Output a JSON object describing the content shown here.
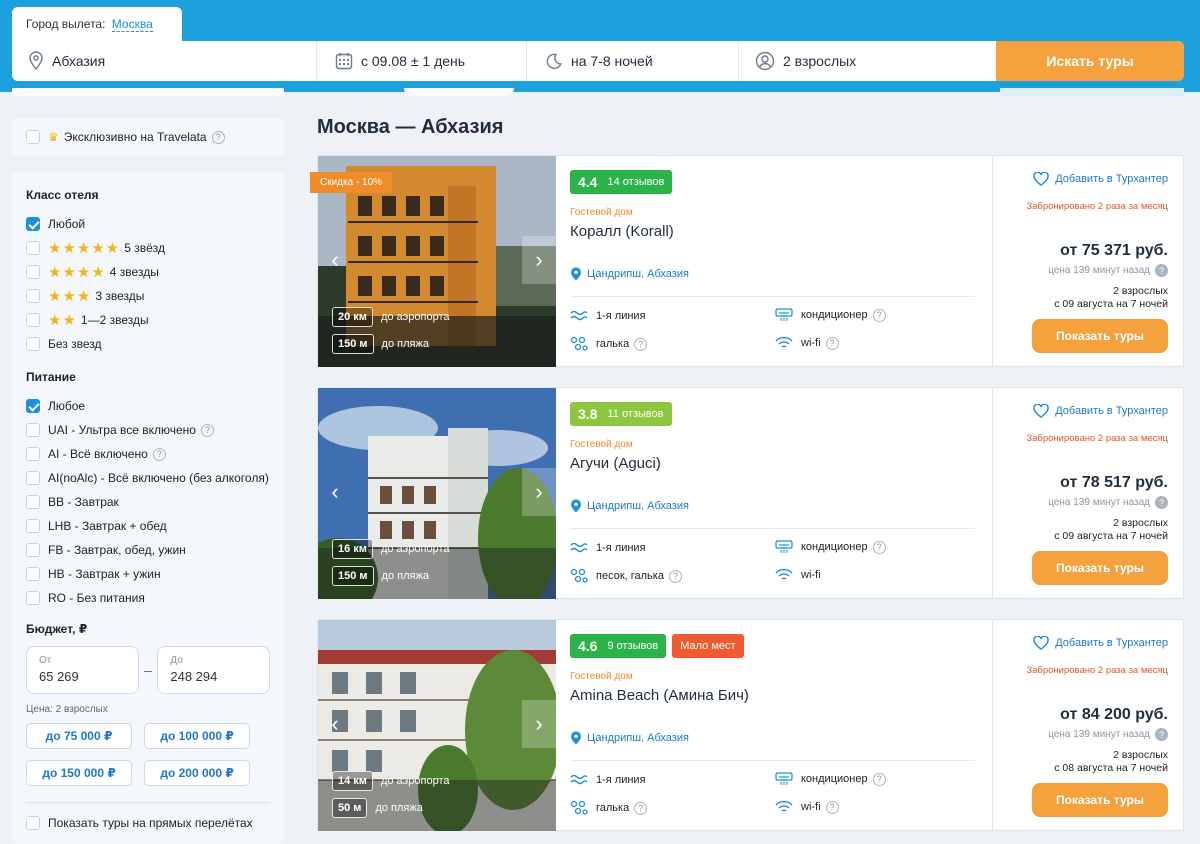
{
  "search": {
    "departure_label": "Город вылета:",
    "departure_city": "Москва",
    "destination": "Абхазия",
    "date": "с 09.08 ± 1 день",
    "nights": "на 7-8 ночей",
    "people": "2 взрослых",
    "button": "Искать туры"
  },
  "sidebar": {
    "exclusive_label": "Эксклюзивно на Travelata",
    "hotel_class": {
      "title": "Класс отеля",
      "options": [
        {
          "label": "Любой",
          "checked": true
        },
        {
          "label": "5 звёзд",
          "stars": "★★★★★"
        },
        {
          "label": "4 звезды",
          "stars": "★★★★"
        },
        {
          "label": "3 звезды",
          "stars": "★★★"
        },
        {
          "label": "1—2 звезды",
          "stars": "★★"
        },
        {
          "label": "Без звезд"
        }
      ]
    },
    "meals": {
      "title": "Питание",
      "options": [
        {
          "label": "Любое",
          "checked": true
        },
        {
          "label": "UAI - Ультра все включено",
          "help": true
        },
        {
          "label": "AI - Всё включено",
          "help": true
        },
        {
          "label": "AI(noAlc) - Всё включено (без алкоголя)"
        },
        {
          "label": "BB - Завтрак"
        },
        {
          "label": "LHB - Завтрак + обед"
        },
        {
          "label": "FB - Завтрак, обед, ужин"
        },
        {
          "label": "HB - Завтрак + ужин"
        },
        {
          "label": "RO - Без питания"
        }
      ]
    },
    "budget": {
      "title": "Бюджет, ₽",
      "from_label": "От",
      "from_value": "65 269",
      "to_label": "До",
      "to_value": "248 294",
      "note": "Цена: 2 взрослых",
      "presets": [
        "до 75 000 ₽",
        "до 100 000 ₽",
        "до 150 000 ₽",
        "до 200 000 ₽"
      ]
    },
    "direct_flights_label": "Показать туры на прямых перелётах"
  },
  "main": {
    "title": "Москва — Абхазия",
    "hotels": [
      {
        "discount": "Скидка - 10%",
        "rating": "4.4",
        "reviews": "14 отзывов",
        "rating_color": "#2bb34a",
        "type": "Гостевой дом",
        "name": "Коралл (Korall)",
        "location": "Цандрипш, Абхазия",
        "airport_km": "20 км",
        "airport_label": "до аэропорта",
        "beach_m": "150 м",
        "beach_label": "до пляжа",
        "line": "1-я линия",
        "beach_type": "галька",
        "ac": "кондиционер",
        "wifi": "wi-fi",
        "favorite": "Добавить в Турхантер",
        "booked": "Забронировано 2 раза за месяц",
        "price": "от 75 371 руб.",
        "price_age": "цена 139 минут назад",
        "pax": "2 взрослых",
        "dates": "с 09 августа на 7 ночей",
        "button": "Показать туры"
      },
      {
        "rating": "3.8",
        "reviews": "11 отзывов",
        "rating_color": "#8dc63f",
        "type": "Гостевой дом",
        "name": "Агучи (Aguci)",
        "location": "Цандрипш, Абхазия",
        "airport_km": "16 км",
        "airport_label": "до аэропорта",
        "beach_m": "150 м",
        "beach_label": "до пляжа",
        "line": "1-я линия",
        "beach_type": "песок, галька",
        "ac": "кондиционер",
        "wifi": "wi-fi",
        "favorite": "Добавить в Турхантер",
        "booked": "Забронировано 2 раза за месяц",
        "price": "от 78 517 руб.",
        "price_age": "цена 139 минут назад",
        "pax": "2 взрослых",
        "dates": "с 09 августа на 7 ночей",
        "button": "Показать туры"
      },
      {
        "rating": "4.6",
        "reviews": "9 отзывов",
        "rating_color": "#2bb34a",
        "few_places": "Мало мест",
        "type": "Гостевой дом",
        "name": "Amina Beach (Амина Бич)",
        "location": "Цандрипш, Абхазия",
        "airport_km": "14 км",
        "airport_label": "до аэропорта",
        "beach_m": "50 м",
        "beach_label": "до пляжа",
        "line": "1-я линия",
        "beach_type": "галька",
        "ac": "кондиционер",
        "wifi": "wi-fi",
        "favorite": "Добавить в Турхантер",
        "booked": "Забронировано 2 раза за месяц",
        "price": "от 84 200 руб.",
        "price_age": "цена 139 минут назад",
        "pax": "2 взрослых",
        "dates": "с 08 августа на 7 ночей",
        "button": "Показать туры"
      }
    ]
  },
  "colors": {
    "brand_blue": "#1da1dc",
    "accent_orange": "#f5a13d",
    "link_blue": "#1e78c8",
    "booked_red": "#e8552a"
  }
}
